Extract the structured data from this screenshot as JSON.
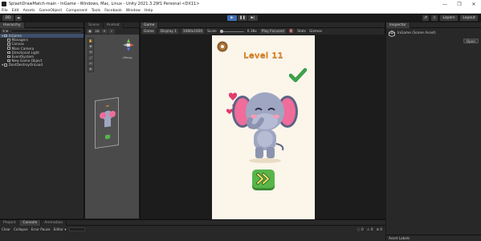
{
  "window": {
    "title": "SplashDrawMatch-main - InGame - Windows, Mac, Linux - Unity 2021.3.29f1 Personal <DX11>",
    "controls": [
      "—",
      "❐",
      "✕"
    ]
  },
  "menu": [
    "File",
    "Edit",
    "Assets",
    "GameObject",
    "Component",
    "Tools",
    "Facebook",
    "Window",
    "Help"
  ],
  "toolbar": {
    "account": "DD",
    "play": "▶",
    "pause": "❚❚",
    "step": "▶|",
    "layers": "Layers",
    "layout": "Layout"
  },
  "hierarchy": {
    "tab": "Hierarchy",
    "add": "+ ▾",
    "items": [
      {
        "label": "InGame",
        "depth": 0,
        "selected": true
      },
      {
        "label": "Managers",
        "depth": 2
      },
      {
        "label": "Canvas",
        "depth": 2
      },
      {
        "label": "Main Camera",
        "depth": 2
      },
      {
        "label": "Directional Light",
        "depth": 2
      },
      {
        "label": "EventSystem",
        "depth": 2
      },
      {
        "label": "New Game Object",
        "depth": 2
      },
      {
        "label": "DontDestroyOnLoad",
        "depth": 0
      }
    ]
  },
  "scene": {
    "tabs": [
      "Scene",
      "Animat"
    ],
    "persp_label": "<Persp",
    "tools": [
      "✋",
      "✥",
      "⟲",
      "⤢",
      "▭",
      "⊕"
    ]
  },
  "game": {
    "tab": "Game",
    "display_mode": "Game",
    "display": "Display 1",
    "resolution": "1080x1920",
    "scale_label": "Scale",
    "scale_value": "0.38x",
    "play_focused": "Play Focused",
    "stats": "Stats",
    "gizmos": "Gizmos",
    "level_label": "Level 11"
  },
  "inspector": {
    "tab": "Inspector",
    "object_name": "InGame (Scene Asset)",
    "open_button": "Open",
    "asset_labels": "Asset Labels"
  },
  "bottom": {
    "tabs": [
      "Project",
      "Console",
      "Animation"
    ],
    "clear": "Clear",
    "collapse": "Collapse",
    "error_pause": "Error Pause",
    "editor": "Editor ▾",
    "counts": [
      "0",
      "0",
      "0"
    ]
  },
  "colors": {
    "accent_play": "#3d6fb7",
    "level_text": "#e28a2c",
    "check_green": "#3aa64a",
    "next_button": "#57b54a",
    "elephant_body": "#9fa6c2",
    "elephant_ear": "#ef6c9b"
  }
}
